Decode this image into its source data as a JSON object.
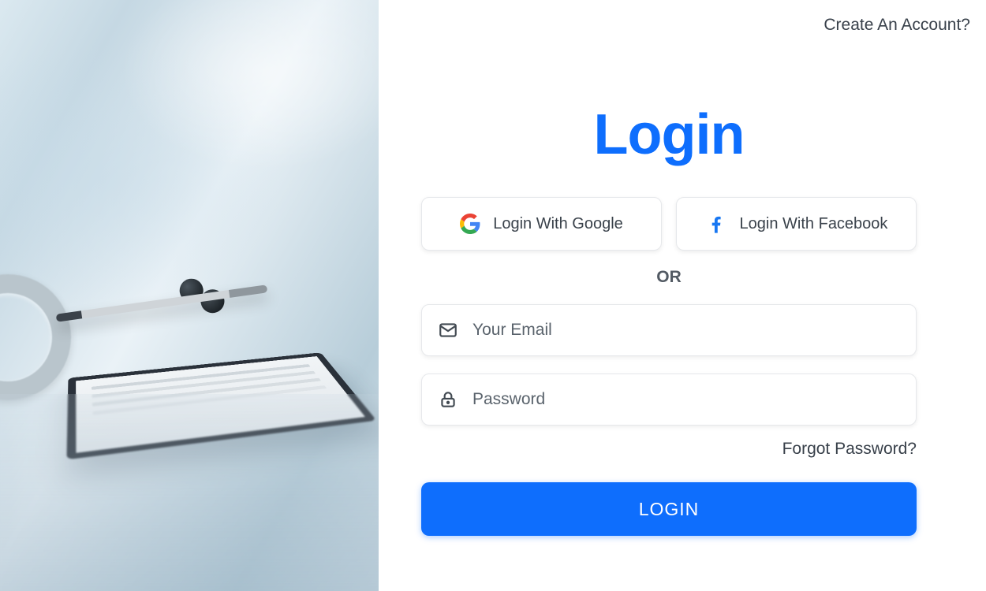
{
  "top": {
    "create_account": "Create An Account?"
  },
  "login": {
    "title": "Login",
    "google_label": "Login With Google",
    "facebook_label": "Login With Facebook",
    "or_label": "OR",
    "email_placeholder": "Your Email",
    "password_placeholder": "Password",
    "forgot_label": "Forgot Password?",
    "submit_label": "LOGIN"
  }
}
